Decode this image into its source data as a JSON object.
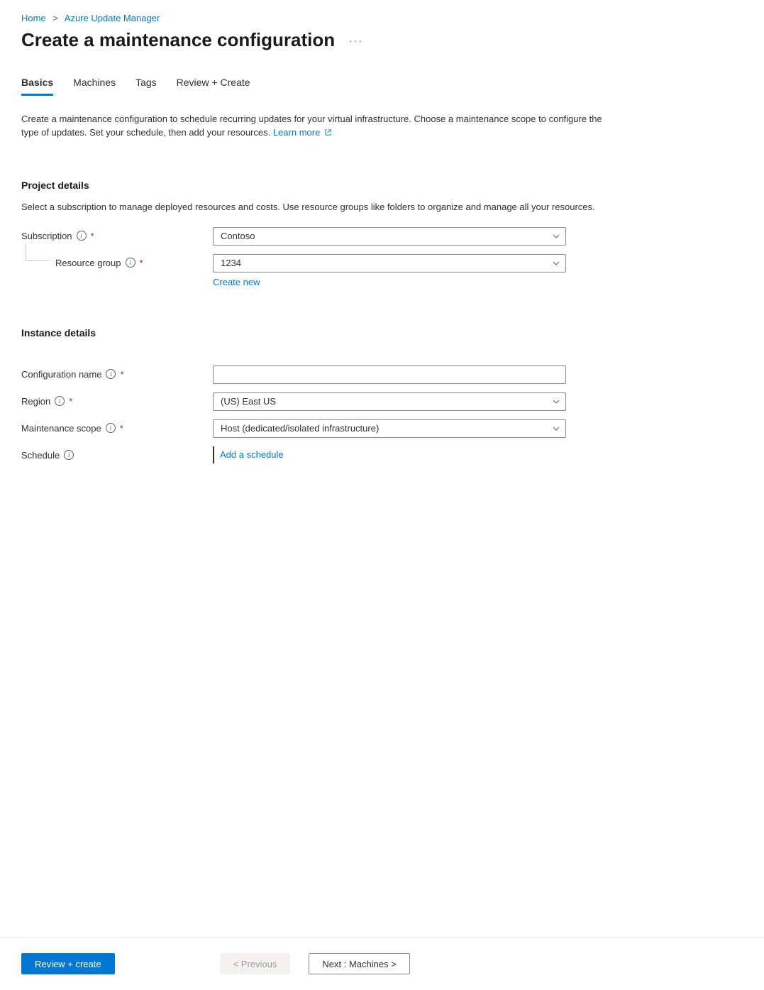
{
  "breadcrumb": {
    "home": "Home",
    "section": "Azure Update Manager"
  },
  "title": "Create a maintenance configuration",
  "tabs": {
    "basics": "Basics",
    "machines": "Machines",
    "tags": "Tags",
    "review": "Review + Create"
  },
  "intro": {
    "text": "Create a maintenance configuration to schedule recurring updates for your virtual infrastructure. Choose a maintenance scope to configure the type of updates. Set your schedule, then add your resources. ",
    "learn_more": "Learn more"
  },
  "project": {
    "heading": "Project details",
    "desc": "Select a subscription to manage deployed resources and costs. Use resource groups like folders to organize and manage all your resources.",
    "subscription_label": "Subscription",
    "subscription_value": "Contoso",
    "resource_group_label": "Resource group",
    "resource_group_value": "1234",
    "create_new": "Create new"
  },
  "instance": {
    "heading": "Instance details",
    "config_name_label": "Configuration name",
    "config_name_value": "",
    "region_label": "Region",
    "region_value": "(US) East US",
    "scope_label": "Maintenance scope",
    "scope_value": "Host (dedicated/isolated infrastructure)",
    "schedule_label": "Schedule",
    "add_schedule": "Add a schedule"
  },
  "footer": {
    "review_create": "Review + create",
    "previous": "< Previous",
    "next": "Next : Machines >"
  }
}
